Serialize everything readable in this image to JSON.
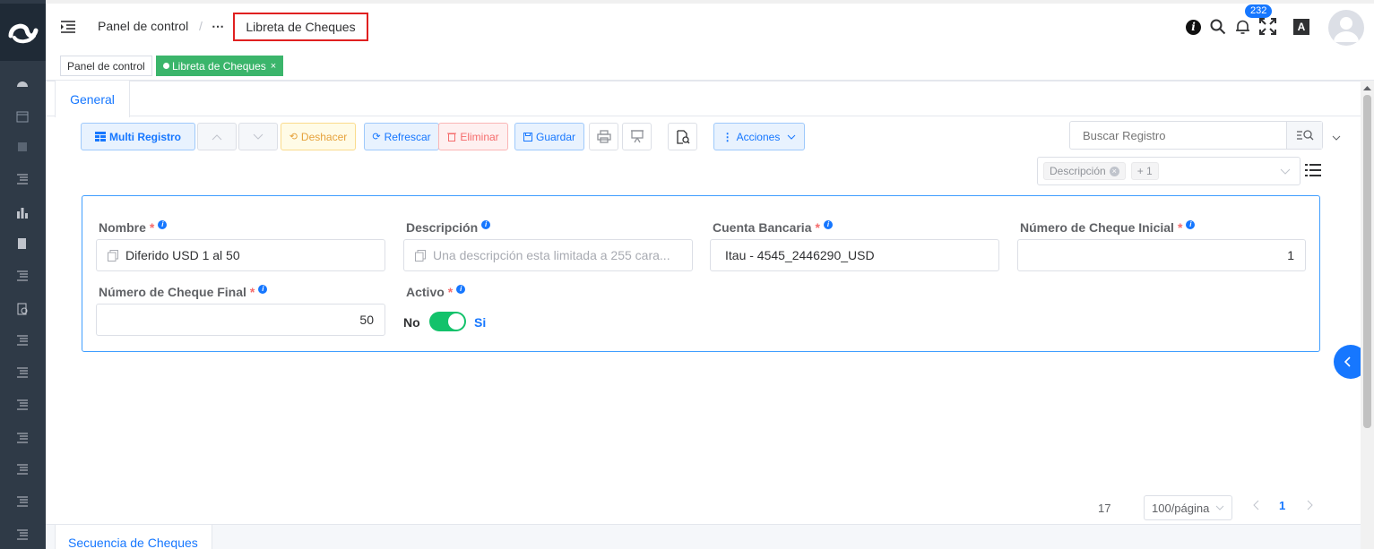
{
  "breadcrumb": {
    "home": "Panel de control",
    "ellipsis": "⋯",
    "separator": "/",
    "current": "Libreta de Cheques"
  },
  "header": {
    "notifications_count": "232"
  },
  "tags": [
    {
      "label": "Panel de control"
    },
    {
      "label": "Libreta de Cheques",
      "close": "×"
    }
  ],
  "tabs": {
    "general": "General",
    "bottom": "Secuencia de Cheques"
  },
  "toolbar": {
    "multi": "Multi Registro",
    "undo": "Deshacer",
    "refresh": "Refrescar",
    "delete": "Eliminar",
    "save": "Guardar",
    "actions": "Acciones"
  },
  "search": {
    "placeholder": "Buscar Registro"
  },
  "filter": {
    "chip": "Descripción",
    "more": "+ 1"
  },
  "form": {
    "nombre_label": "Nombre",
    "nombre_value": "Diferido USD 1 al 50",
    "desc_label": "Descripción",
    "desc_placeholder": "Una descripción esta limitada a 255 cara...",
    "cuenta_label": "Cuenta Bancaria",
    "cuenta_value": "Itau - 4545_2446290_USD",
    "inicial_label": "Número de Cheque Inicial",
    "inicial_value": "1",
    "final_label": "Número de Cheque Final",
    "final_value": "50",
    "activo_label": "Activo",
    "no": "No",
    "si": "Si",
    "required": "*"
  },
  "pagination": {
    "total": "17",
    "page_size": "100/página",
    "page": "1"
  },
  "colors": {
    "accent": "#409eff",
    "green": "#13c26b",
    "sidebar": "#2f3a47"
  }
}
